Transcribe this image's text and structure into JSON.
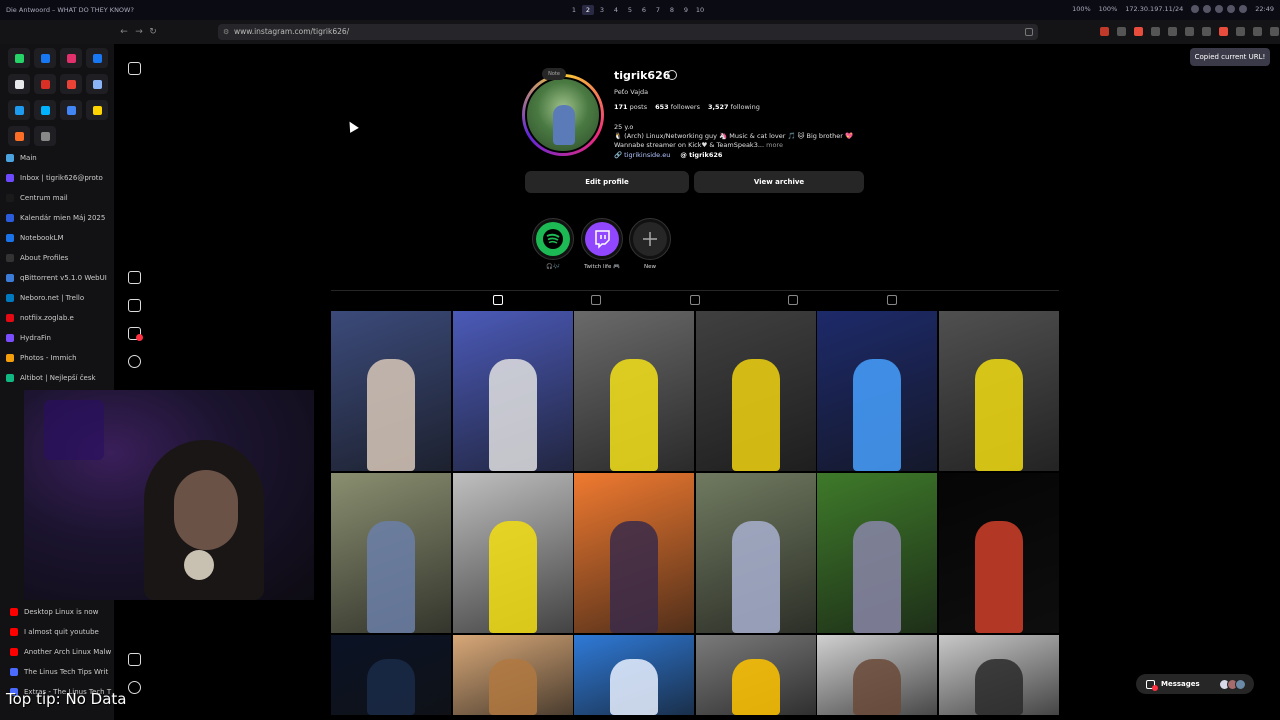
{
  "window": {
    "title": "Die Antwoord – WHAT DO THEY KNOW?",
    "workspaces": [
      "1",
      "2",
      "3",
      "4",
      "5",
      "6",
      "7",
      "8",
      "9",
      "10"
    ],
    "active_workspace": "2",
    "status": [
      "100%",
      "100%",
      "172.30.197.11/24",
      "22:49"
    ]
  },
  "browser": {
    "url": "www.instagram.com/tigrik626/",
    "toast": "Copied current URL!",
    "nav": {
      "back": "←",
      "forward": "→",
      "reload": "↻"
    }
  },
  "sidebar": {
    "pinned_colors": [
      "#25d366",
      "#1877f2",
      "#e1306c",
      "#1877f2",
      "#e7e9ea",
      "#d93025",
      "#ea4335",
      "#8ab4f8",
      "#1d9bf0",
      "#00b2ff",
      "#4285f4",
      "#ffd400",
      "#fc6d26",
      "#888888"
    ],
    "tabs": [
      {
        "label": "Main",
        "color": "#4aa3df"
      },
      {
        "label": "Inbox | tigrik626@proto",
        "color": "#6d4aff"
      },
      {
        "label": "Centrum mail",
        "color": "#1a1a1a"
      },
      {
        "label": "Kalendár mien Máj 2025",
        "color": "#2a5cdb"
      },
      {
        "label": "NotebookLM",
        "color": "#1a73e8"
      },
      {
        "label": "About Profiles",
        "color": "#333333"
      },
      {
        "label": "qBittorrent v5.1.0 WebUI",
        "color": "#3d7bd9"
      },
      {
        "label": "Neboro.net | Trello",
        "color": "#0079bf"
      },
      {
        "label": "notfiix.zoglab.e",
        "color": "#e50914"
      },
      {
        "label": "HydraFin",
        "color": "#7a4dff"
      },
      {
        "label": "Photos - Immich",
        "color": "#f59e0b"
      },
      {
        "label": "Altibot | Nejlepší česk",
        "color": "#10b981"
      }
    ],
    "lower_tabs": [
      {
        "label": "Desktop Linux is now",
        "color": "#ff0000"
      },
      {
        "label": "I almost quit youtube",
        "color": "#ff0000"
      },
      {
        "label": "Another Arch Linux Malw",
        "color": "#ff0000"
      },
      {
        "label": "The Linus Tech Tips Writ",
        "color": "#4b6bff"
      },
      {
        "label": "Extras - The Linus Tech T",
        "color": "#4b6bff"
      }
    ]
  },
  "overlay": {
    "top_tip": "Top tip: No Data"
  },
  "profile": {
    "note": "Note",
    "username": "tigrik626",
    "full_name": "Peťo Vajda",
    "posts_count": "171",
    "posts_label": "posts",
    "followers_count": "653",
    "followers_label": "followers",
    "following_count": "3,527",
    "following_label": "following",
    "bio_line1": "25 y.o",
    "bio_line2": "🐧 (Arch) Linux/Networking guy 🦄 Music & cat lover 🎵 🐱 Big brother 💖",
    "bio_line3": "Wannabe streamer on Kick♥ & TeamSpeak3...",
    "bio_more": "more",
    "link": "tigrikinside.eu",
    "threads": "tigrik626",
    "edit_button": "Edit profile",
    "archive_button": "View archive"
  },
  "highlights": [
    {
      "label": "🎧🎶",
      "color": "#1db954"
    },
    {
      "label": "Twitch life 🎮",
      "color": "#9146ff"
    },
    {
      "label": "New",
      "color": "#262626"
    }
  ],
  "posts": [
    {
      "bg": "#3b4a7a",
      "accent": "#d8c8b8"
    },
    {
      "bg": "#4b5ab8",
      "accent": "#e0e0e0"
    },
    {
      "bg": "#6a6a6a",
      "accent": "#f4e21a"
    },
    {
      "bg": "#404040",
      "accent": "#f1d20f"
    },
    {
      "bg": "#1d2a6a",
      "accent": "#46a0ff"
    },
    {
      "bg": "#505050",
      "accent": "#f2dc12"
    },
    {
      "bg": "#8a8f70",
      "accent": "#6b7fa8"
    },
    {
      "bg": "#bfbfbf",
      "accent": "#f2dd10"
    },
    {
      "bg": "#f07a30",
      "accent": "#3a2a4a"
    },
    {
      "bg": "#707a60",
      "accent": "#a8b0d0"
    },
    {
      "bg": "#3e7a2a",
      "accent": "#8a86a8"
    },
    {
      "bg": "#050505",
      "accent": "#d0402a"
    },
    {
      "bg": "#0a1225",
      "accent": "#1a2a48"
    },
    {
      "bg": "#d8a878",
      "accent": "#b07840"
    },
    {
      "bg": "#2f7ad8",
      "accent": "#e8f0ff"
    },
    {
      "bg": "#7a7a7a",
      "accent": "#ffc400"
    },
    {
      "bg": "#d0d0d0",
      "accent": "#6a4a3a"
    },
    {
      "bg": "#c8c8c8",
      "accent": "#2a2a2a"
    }
  ],
  "messages": {
    "label": "Messages",
    "avatar_colors": [
      "#d8d8e8",
      "#a86b6b",
      "#6b8aa8"
    ]
  }
}
